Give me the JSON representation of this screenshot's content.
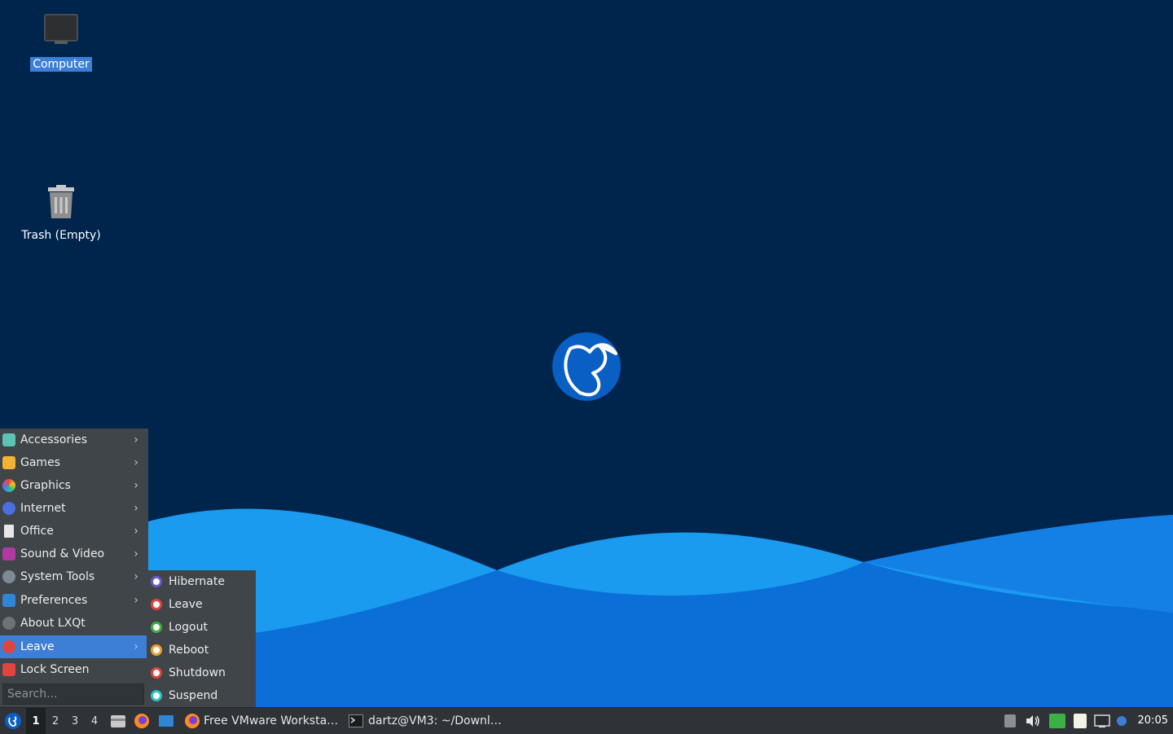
{
  "desktop": {
    "icons": [
      {
        "label": "Computer",
        "icon": "computer-icon",
        "selected": true
      },
      {
        "label": "Trash (Empty)",
        "icon": "trash-icon",
        "selected": false
      }
    ],
    "wallpaper": {
      "background": "#00254d",
      "wave_colors": [
        "#1a9bf0",
        "#0a6fd6",
        "#3fb1ff"
      ],
      "logo": "lubuntu-logo"
    }
  },
  "start_menu": {
    "items": [
      {
        "label": "Accessories",
        "icon": "accessories-icon",
        "submenu": true
      },
      {
        "label": "Games",
        "icon": "games-icon",
        "submenu": true
      },
      {
        "label": "Graphics",
        "icon": "graphics-icon",
        "submenu": true
      },
      {
        "label": "Internet",
        "icon": "internet-icon",
        "submenu": true
      },
      {
        "label": "Office",
        "icon": "office-icon",
        "submenu": true
      },
      {
        "label": "Sound & Video",
        "icon": "sound-video-icon",
        "submenu": true
      },
      {
        "label": "System Tools",
        "icon": "system-tools-icon",
        "submenu": true
      },
      {
        "label": "Preferences",
        "icon": "preferences-icon",
        "submenu": true
      },
      {
        "label": "About LXQt",
        "icon": "info-icon",
        "submenu": false
      },
      {
        "label": "Leave",
        "icon": "power-icon",
        "submenu": true,
        "active": true
      },
      {
        "label": "Lock Screen",
        "icon": "lock-icon",
        "submenu": false
      }
    ],
    "search_placeholder": "Search..."
  },
  "leave_submenu": {
    "items": [
      {
        "label": "Hibernate",
        "icon": "hibernate-icon",
        "color": "#6a5acd"
      },
      {
        "label": "Leave",
        "icon": "power-icon",
        "color": "#e0443e"
      },
      {
        "label": "Logout",
        "icon": "logout-icon",
        "color": "#3cb043"
      },
      {
        "label": "Reboot",
        "icon": "reboot-icon",
        "color": "#f0a030"
      },
      {
        "label": "Shutdown",
        "icon": "shutdown-icon",
        "color": "#e0443e"
      },
      {
        "label": "Suspend",
        "icon": "suspend-icon",
        "color": "#2ec4c4"
      }
    ]
  },
  "taskbar": {
    "desktops": [
      "1",
      "2",
      "3",
      "4"
    ],
    "active_desktop": "1",
    "quicklaunch": [
      "file-manager-icon",
      "firefox-icon",
      "desktop-icon"
    ],
    "tasks": [
      {
        "label": "Free VMware Worksta…",
        "icon": "firefox-icon"
      },
      {
        "label": "dartz@VM3: ~/Downl…",
        "icon": "terminal-icon"
      }
    ],
    "tray": [
      "show-tray-icon",
      "volume-icon",
      "update-icon",
      "clipboard-icon",
      "network-icon",
      "notification-icon"
    ],
    "clock": "20:05"
  },
  "colors": {
    "menu_bg": "#3f4549",
    "accent": "#3d7fd6",
    "taskbar_bg": "#2f3236"
  }
}
